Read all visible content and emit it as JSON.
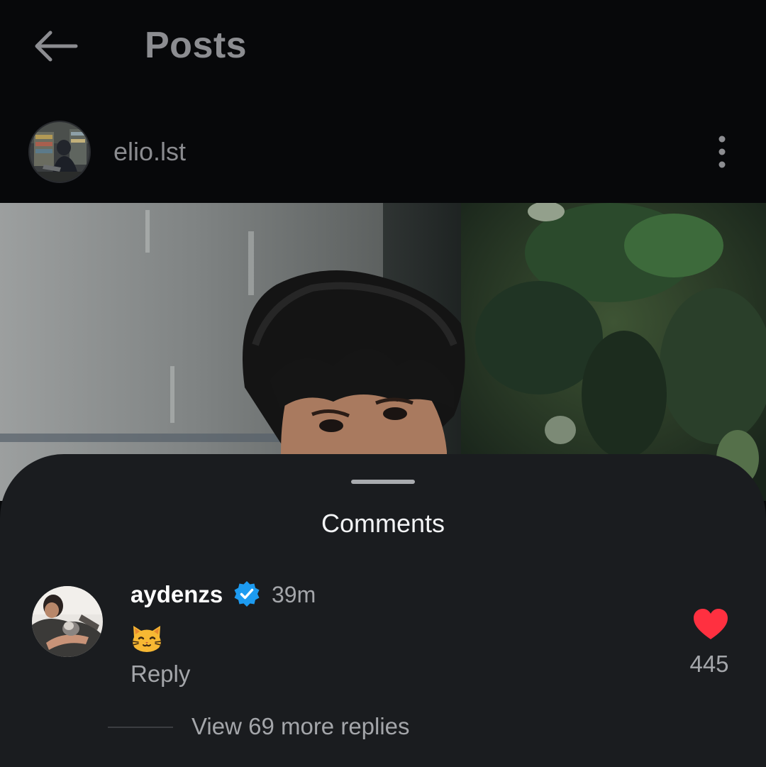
{
  "header": {
    "title": "Posts",
    "back_icon": "arrow-left-icon"
  },
  "post": {
    "author": "elio.lst",
    "more_icon": "more-vertical-icon"
  },
  "comments_sheet": {
    "title": "Comments",
    "comment": {
      "username": "aydenzs",
      "verified": true,
      "verified_color": "#1d9bf0",
      "time": "39m",
      "text_emoji": "cat-face-emoji",
      "reply_label": "Reply",
      "like_count": "445",
      "liked": true,
      "like_color": "#ff3040",
      "view_replies_label": "View 69 more replies"
    }
  }
}
